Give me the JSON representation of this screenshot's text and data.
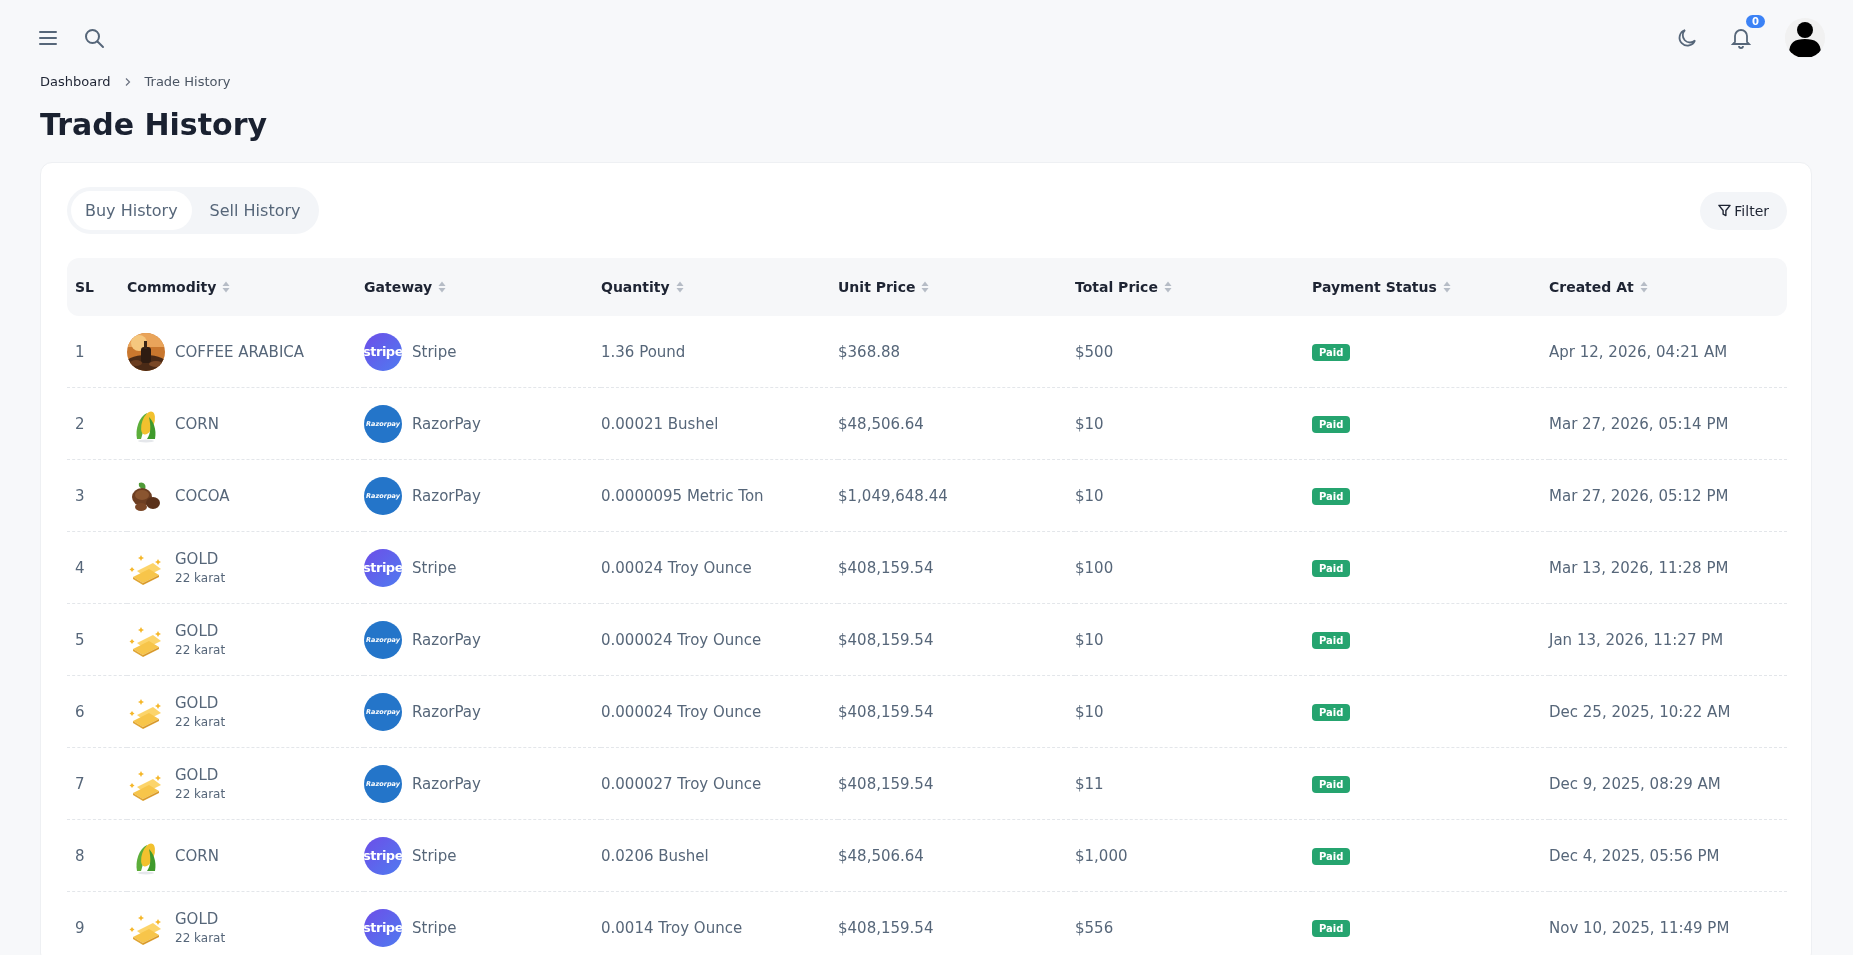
{
  "topbar": {
    "notification_count": "0"
  },
  "breadcrumb": [
    "Dashboard",
    "Trade History"
  ],
  "title": "Trade History",
  "tabs": [
    {
      "label": "Buy History",
      "selected": true
    },
    {
      "label": "Sell History",
      "selected": false
    }
  ],
  "filter_button": "Filter",
  "table": {
    "columns": [
      {
        "label": "SL",
        "sortable": false
      },
      {
        "label": "Commodity",
        "sortable": true
      },
      {
        "label": "Gateway",
        "sortable": true
      },
      {
        "label": "Quantity",
        "sortable": true
      },
      {
        "label": "Unit Price",
        "sortable": true
      },
      {
        "label": "Total Price",
        "sortable": true
      },
      {
        "label": "Payment Status",
        "sortable": true
      },
      {
        "label": "Created At",
        "sortable": true
      }
    ],
    "rows": [
      {
        "sl": "1",
        "commodity": {
          "kind": "coffee",
          "name": "COFFEE ARABICA"
        },
        "gateway": {
          "kind": "stripe",
          "logo_text": "stripe",
          "name": "Stripe"
        },
        "quantity": "1.36 Pound",
        "unit_price": "$368.88",
        "total_price": "$500",
        "status": {
          "kind": "paid",
          "label": "Paid"
        },
        "created_at": "Apr 12, 2026, 04:21 AM"
      },
      {
        "sl": "2",
        "commodity": {
          "kind": "corn",
          "name": "CORN"
        },
        "gateway": {
          "kind": "razorpay",
          "logo_text": "Razorpay",
          "name": "RazorPay"
        },
        "quantity": "0.00021 Bushel",
        "unit_price": "$48,506.64",
        "total_price": "$10",
        "status": {
          "kind": "paid",
          "label": "Paid"
        },
        "created_at": "Mar 27, 2026, 05:14 PM"
      },
      {
        "sl": "3",
        "commodity": {
          "kind": "cocoa",
          "name": "COCOA"
        },
        "gateway": {
          "kind": "razorpay",
          "logo_text": "Razorpay",
          "name": "RazorPay"
        },
        "quantity": "0.0000095 Metric Ton",
        "unit_price": "$1,049,648.44",
        "total_price": "$10",
        "status": {
          "kind": "paid",
          "label": "Paid"
        },
        "created_at": "Mar 27, 2026, 05:12 PM"
      },
      {
        "sl": "4",
        "commodity": {
          "kind": "gold",
          "name": "GOLD",
          "variant": "22 karat"
        },
        "gateway": {
          "kind": "stripe",
          "logo_text": "stripe",
          "name": "Stripe"
        },
        "quantity": "0.00024 Troy Ounce",
        "unit_price": "$408,159.54",
        "total_price": "$100",
        "status": {
          "kind": "paid",
          "label": "Paid"
        },
        "created_at": "Mar 13, 2026, 11:28 PM"
      },
      {
        "sl": "5",
        "commodity": {
          "kind": "gold",
          "name": "GOLD",
          "variant": "22 karat"
        },
        "gateway": {
          "kind": "razorpay",
          "logo_text": "Razorpay",
          "name": "RazorPay"
        },
        "quantity": "0.000024 Troy Ounce",
        "unit_price": "$408,159.54",
        "total_price": "$10",
        "status": {
          "kind": "paid",
          "label": "Paid"
        },
        "created_at": "Jan 13, 2026, 11:27 PM"
      },
      {
        "sl": "6",
        "commodity": {
          "kind": "gold",
          "name": "GOLD",
          "variant": "22 karat"
        },
        "gateway": {
          "kind": "razorpay",
          "logo_text": "Razorpay",
          "name": "RazorPay"
        },
        "quantity": "0.000024 Troy Ounce",
        "unit_price": "$408,159.54",
        "total_price": "$10",
        "status": {
          "kind": "paid",
          "label": "Paid"
        },
        "created_at": "Dec 25, 2025, 10:22 AM"
      },
      {
        "sl": "7",
        "commodity": {
          "kind": "gold",
          "name": "GOLD",
          "variant": "22 karat"
        },
        "gateway": {
          "kind": "razorpay",
          "logo_text": "Razorpay",
          "name": "RazorPay"
        },
        "quantity": "0.000027 Troy Ounce",
        "unit_price": "$408,159.54",
        "total_price": "$11",
        "status": {
          "kind": "paid",
          "label": "Paid"
        },
        "created_at": "Dec 9, 2025, 08:29 AM"
      },
      {
        "sl": "8",
        "commodity": {
          "kind": "corn",
          "name": "CORN"
        },
        "gateway": {
          "kind": "stripe",
          "logo_text": "stripe",
          "name": "Stripe"
        },
        "quantity": "0.0206 Bushel",
        "unit_price": "$48,506.64",
        "total_price": "$1,000",
        "status": {
          "kind": "paid",
          "label": "Paid"
        },
        "created_at": "Dec 4, 2025, 05:56 PM"
      },
      {
        "sl": "9",
        "commodity": {
          "kind": "gold",
          "name": "GOLD",
          "variant": "22 karat"
        },
        "gateway": {
          "kind": "stripe",
          "logo_text": "stripe",
          "name": "Stripe"
        },
        "quantity": "0.0014 Troy Ounce",
        "unit_price": "$408,159.54",
        "total_price": "$556",
        "status": {
          "kind": "paid",
          "label": "Paid"
        },
        "created_at": "Nov 10, 2025, 11:49 PM"
      }
    ]
  }
}
